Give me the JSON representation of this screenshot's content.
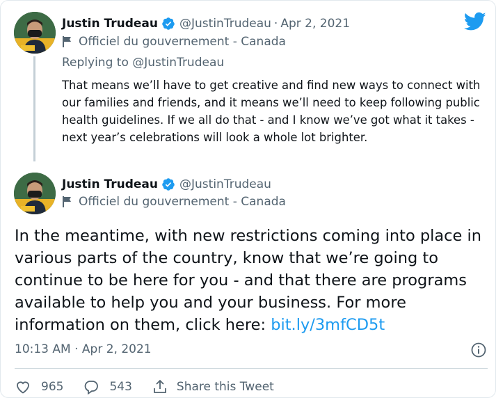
{
  "colors": {
    "brand": "#1d9bf0",
    "text": "#0f1419",
    "muted": "#536471"
  },
  "icons": [
    "twitter-logo-icon",
    "verified-badge-icon",
    "flag-icon",
    "info-icon",
    "heart-icon",
    "reply-bubble-icon",
    "share-icon"
  ],
  "thread": {
    "first_tweet": {
      "author": "Justin Trudeau",
      "handle": "@JustinTrudeau",
      "separator": "·",
      "date": "Apr 2, 2021",
      "label": "Officiel du gouvernement - Canada",
      "replying_prefix": "Replying to",
      "replying_handle": "@JustinTrudeau",
      "text": "That means we’ll have to get creative and find new ways to connect with our families and friends, and it means we’ll need to keep following public health guidelines. If we all do that - and I know we’ve got what it takes - next year’s celebrations will look a whole lot brighter."
    },
    "main_tweet": {
      "author": "Justin Trudeau",
      "handle": "@JustinTrudeau",
      "label": "Officiel du gouvernement - Canada",
      "text": "In the meantime, with new restrictions coming into place in various parts of the country, know that we’re going to continue to be here for you - and that there are programs available to help you and your business. For more information on them, click here: ",
      "link": "bit.ly/3mfCD5t",
      "timestamp": "10:13 AM · Apr 2, 2021"
    }
  },
  "actions": {
    "likes": "965",
    "replies": "543",
    "share_label": "Share this Tweet"
  }
}
